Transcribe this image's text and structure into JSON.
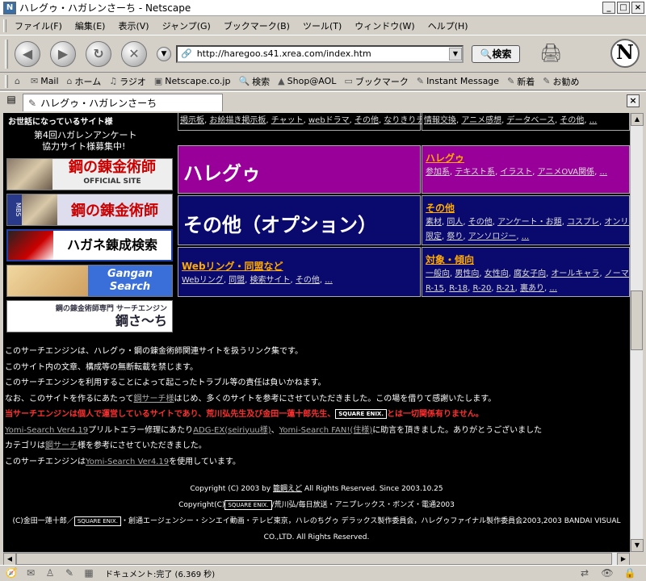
{
  "window": {
    "title": "ハレグゥ・ハガレンさーち - Netscape"
  },
  "menu": [
    "ファイル(F)",
    "編集(E)",
    "表示(V)",
    "ジャンプ(G)",
    "ブックマーク(B)",
    "ツール(T)",
    "ウィンドウ(W)",
    "ヘルプ(H)"
  ],
  "nav": {
    "url": "http://haregoo.s41.xrea.com/index.htm",
    "search_label": "検索"
  },
  "personal_toolbar": [
    "Mail",
    "ホーム",
    "ラジオ",
    "Netscape.co.jp",
    "検索",
    "Shop@AOL",
    "ブックマーク",
    "Instant Message",
    "新着",
    "お勧め"
  ],
  "tab": {
    "label": "ハレグゥ・ハガレンさーち"
  },
  "sidebar": {
    "header": "お世話になっているサイト様",
    "hand_line1": "第4回ハガレンアンケート",
    "hand_line2": "協力サイト様募集中!",
    "banners": [
      {
        "text": "鋼の錬金術師",
        "sub": "OFFICIAL SITE"
      },
      {
        "text": "鋼の錬金術師",
        "sub": "MBS"
      },
      {
        "text": "ハガネ錬成検索",
        "sub": ""
      },
      {
        "text": "Gangan Search",
        "sub": ""
      },
      {
        "text": "鋼さ〜ち",
        "sub": "鋼の錬金術師専門 サーチエンジン"
      }
    ]
  },
  "top_links": {
    "left": [
      "掲示板",
      "お絵描き掲示板",
      "チャット",
      "webドラマ",
      "その他",
      "なりきりチャット",
      "..."
    ],
    "right": [
      "情報交換",
      "アニメ感想",
      "データベース",
      "その他",
      "..."
    ]
  },
  "categories": [
    {
      "big": "ハレグゥ",
      "title": "ハレグゥ",
      "subs": [
        "参加系",
        "テキスト系",
        "イラスト",
        "アニメOVA関係",
        "..."
      ]
    },
    {
      "big": "その他（オプション）",
      "title": "その他",
      "subs": [
        "素材",
        "同人",
        "その他",
        "アンケート・お題",
        "コスプレ",
        "オンリーイベント"
      ],
      "subs2": [
        "限定",
        "祭り",
        "アンソロジー",
        "..."
      ]
    },
    {
      "big": "",
      "title": "Webリング・同盟など",
      "subs": [
        "Webリング",
        "同盟",
        "検索サイト",
        "その他",
        "..."
      ]
    },
    {
      "big": "",
      "title": "対象・傾向",
      "subs": [
        "一般向",
        "男性向",
        "女性向",
        "腐女子向",
        "オールキャラ",
        "ノーマル"
      ],
      "subs2": [
        "R-15",
        "R-18",
        "R-20",
        "R-21",
        "裏あり",
        "..."
      ]
    }
  ],
  "info": {
    "line1": "このサーチエンジンは、ハレグゥ・鋼の錬金術師関連サイトを扱うリンク集です。",
    "line2": "このサイト内の文章、構成等の無断転載を禁じます。",
    "line3": "このサーチエンジンを利用することによって起こったトラブル等の責任は負いかねます。",
    "line4a": "なお、このサイトを作るにあたって",
    "line4link": "鋼サーチ様",
    "line4b": "はじめ、多くのサイトを参考にさせていただきました。この場を借りて感謝いたします。",
    "red_a": "当サーチエンジンは個人で運営しているサイトであり、荒川弘先生及び金田一蓮十郎先生、",
    "red_logo": "SQUARE ENIX.",
    "red_b": "とは一切関係有りません。",
    "line6link1": "Yomi-Search Ver4.19",
    "line6a": "プリルトエラー修理にあたり",
    "line6link2": "ADG-EX(seiriyuu様)",
    "line6sep": "、",
    "line6link3": "Yomi-Search FAN!(住様)",
    "line6b": "に助言を頂きました。ありがとうございました",
    "line7a": "カテゴリは",
    "line7link": "鋼サーチ",
    "line7b": "様を参考にさせていただきました。",
    "line8a": "このサーチエンジンは",
    "line8link": "Yomi-Search Ver4.19",
    "line8b": "を使用しています。"
  },
  "footer": {
    "line1a": "Copyright (C) 2003 by",
    "line1link": "籠鋼えど",
    "line1b": "All Rights Reserved.  Since 2003.10.25",
    "line2a": "Copyright(C)",
    "line2logo": "SQUARE ENIX.",
    "line2b": "/荒川弘/毎日放送・アニプレックス・ボンズ・電通2003",
    "line3a": "(C)金田一蓮十郎／",
    "line3logo": "SQUARE ENIX.",
    "line3b": "・創通エージェンシー・シンエイ動画・テレビ東京，ハレのちグゥ デラックス製作委員会，ハレグゥファイナル製作委員会2003,2003 BANDAI VISUAL",
    "line4": "CO.,LTD. All Rights Reserved."
  },
  "status": {
    "text": "ドキュメント:完了 (6.369 秒)"
  },
  "colors": {
    "magenta_cell": "#990099",
    "navy_cell": "#0a0a6e",
    "warning_red": "#ff3030"
  }
}
